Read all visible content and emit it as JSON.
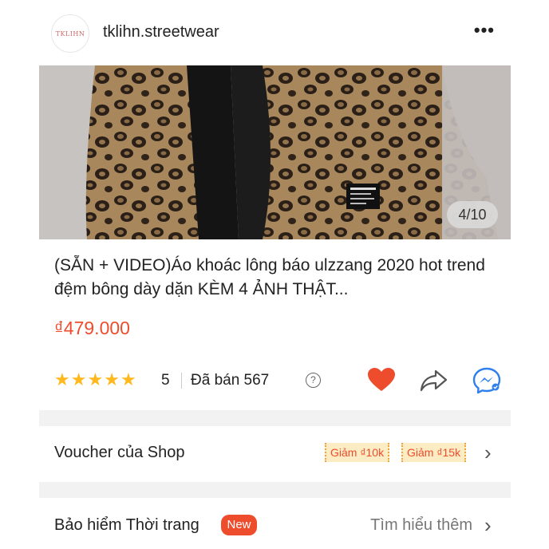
{
  "shop": {
    "name": "tklihn.streetwear",
    "logo_text": "TKLIHN",
    "more_label": "•••"
  },
  "product": {
    "image_counter": "4/10",
    "title": "(SẴN + VIDEO)Áo khoác lông báo ulzzang 2020 hot trend đệm bông dày dặn KÈM 4 ẢNH THẬT...",
    "price": "₫479.000",
    "rating_value": "5",
    "sold_label": "Đã bán 567",
    "help_icon_glyph": "?",
    "star_count": 5
  },
  "voucher": {
    "label": "Voucher của Shop",
    "chips": [
      "Giảm ₫10k",
      "Giảm ₫15k"
    ]
  },
  "insurance": {
    "label": "Bảo hiểm Thời trang",
    "badge": "New",
    "link": "Tìm hiểu thêm"
  },
  "icons": {
    "star": "star-icon",
    "heart": "heart-icon",
    "share": "share-icon",
    "chat": "messenger-icon",
    "chevron": "chevron-right-icon"
  },
  "colors": {
    "accent": "#ee4d2d",
    "star": "#ffb91e",
    "chat_blue": "#2f80ed",
    "voucher_bg": "#fcecc4"
  }
}
